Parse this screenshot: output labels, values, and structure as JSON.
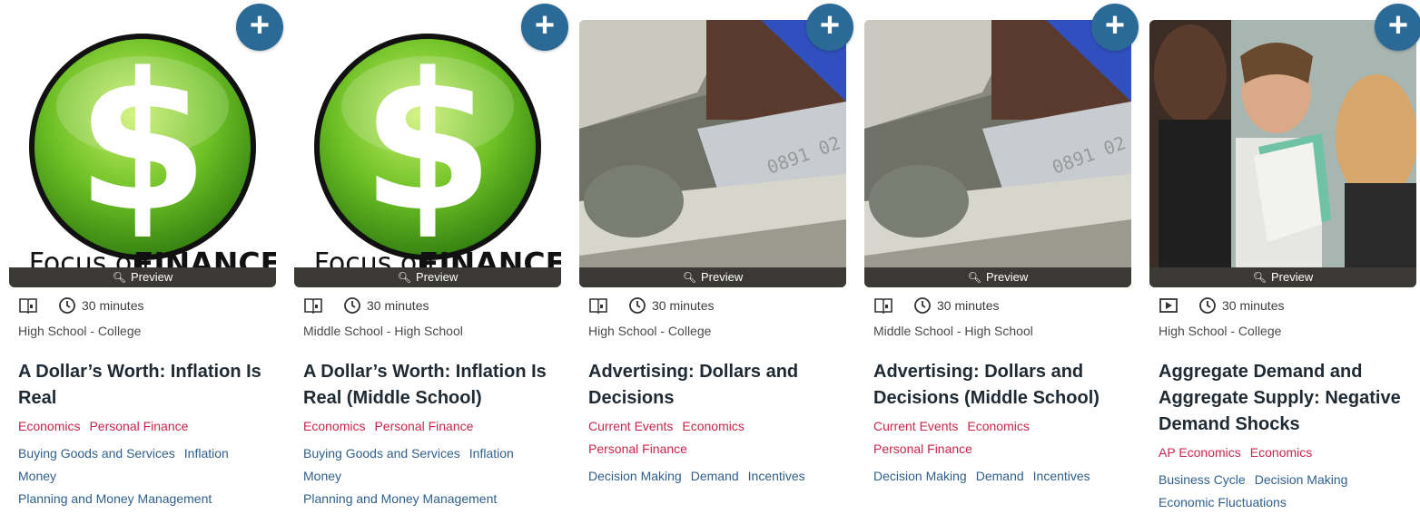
{
  "preview_label": "Preview",
  "cards": [
    {
      "type_icon": "book-icon",
      "duration": "30 minutes",
      "grade": "High School - College",
      "title": "A Dollar’s Worth: Inflation Is Real",
      "category_tags": [
        "Economics",
        "Personal Finance"
      ],
      "concept_tags_lines": [
        [
          "Buying Goods and Services",
          "Inflation"
        ],
        [
          "Money"
        ],
        [
          "Planning and Money Management"
        ]
      ],
      "image": "focus-on-finance-dollar-logo",
      "image_text_1": "Focus on",
      "image_text_2": "FINANCE"
    },
    {
      "type_icon": "book-icon",
      "duration": "30 minutes",
      "grade": "Middle School - High School",
      "title": "A Dollar’s Worth: Inflation Is Real (Middle School)",
      "category_tags": [
        "Economics",
        "Personal Finance"
      ],
      "concept_tags_lines": [
        [
          "Buying Goods and Services",
          "Inflation"
        ],
        [
          "Money"
        ],
        [
          "Planning and Money Management"
        ]
      ],
      "image": "focus-on-finance-dollar-logo",
      "image_text_1": "Focus on",
      "image_text_2": "FINANCE"
    },
    {
      "type_icon": "book-icon",
      "duration": "30 minutes",
      "grade": "High School - College",
      "title": "Advertising: Dollars and Decisions",
      "category_tags_lines": [
        [
          "Current Events",
          "Economics"
        ],
        [
          "Personal Finance"
        ]
      ],
      "concept_tags": [
        "Decision Making",
        "Demand",
        "Incentives"
      ],
      "image": "money-and-credit-cards-photo"
    },
    {
      "type_icon": "book-icon",
      "duration": "30 minutes",
      "grade": "Middle School - High School",
      "title": "Advertising: Dollars and Decisions (Middle School)",
      "category_tags_lines": [
        [
          "Current Events",
          "Economics"
        ],
        [
          "Personal Finance"
        ]
      ],
      "concept_tags": [
        "Decision Making",
        "Demand",
        "Incentives"
      ],
      "image": "money-and-credit-cards-photo"
    },
    {
      "type_icon": "video-icon",
      "duration": "30 minutes",
      "grade": "High School - College",
      "title": "Aggregate Demand and Aggregate Supply: Negative Demand Shocks",
      "category_tags": [
        "AP Economics",
        "Economics"
      ],
      "concept_tags_lines": [
        [
          "Business Cycle",
          "Decision Making"
        ],
        [
          "Economic Fluctuations"
        ]
      ],
      "image": "people-reading-photo"
    }
  ],
  "colors": {
    "add_button": "#2b6a96",
    "category_tag": "#c8264f",
    "concept_tag": "#2f5f8a",
    "preview_bar": "#3b3935"
  }
}
